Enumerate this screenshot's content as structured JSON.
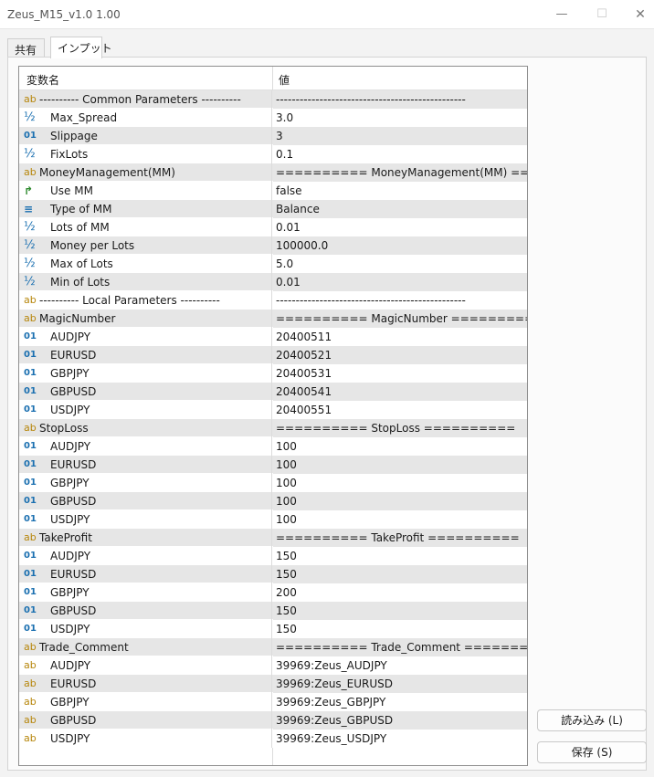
{
  "window": {
    "title": "Zeus_M15_v1.0 1.00",
    "minimize": "—",
    "maximize": "☐",
    "close": "✕"
  },
  "tabs": [
    {
      "label": "共有",
      "active": false
    },
    {
      "label": "インプット",
      "active": true
    }
  ],
  "grid": {
    "col_name": "変数名",
    "col_value": "値",
    "rows": [
      {
        "icon": "ab",
        "icon_name": "string-type-icon",
        "name": "----------    Common Parameters    ----------",
        "value": "------------------------------------------------",
        "top": true
      },
      {
        "icon": "½",
        "icon_name": "double-type-icon",
        "name": "Max_Spread",
        "value": "3.0"
      },
      {
        "icon": "01",
        "icon_name": "integer-type-icon",
        "name": "Slippage",
        "value": "3"
      },
      {
        "icon": "½",
        "icon_name": "double-type-icon",
        "name": "FixLots",
        "value": "0.1"
      },
      {
        "icon": "ab",
        "icon_name": "string-type-icon",
        "name": "MoneyManagement(MM)",
        "value": "  ==========  MoneyManagement(MM) ====...",
        "top": true
      },
      {
        "icon": "↱",
        "icon_name": "bool-type-icon",
        "name": "Use MM",
        "value": "false"
      },
      {
        "icon": "≡",
        "icon_name": "enum-type-icon",
        "name": "Type of MM",
        "value": "Balance"
      },
      {
        "icon": "½",
        "icon_name": "double-type-icon",
        "name": "Lots of MM",
        "value": "0.01"
      },
      {
        "icon": "½",
        "icon_name": "double-type-icon",
        "name": "Money per Lots",
        "value": "100000.0"
      },
      {
        "icon": "½",
        "icon_name": "double-type-icon",
        "name": "Max of Lots",
        "value": "5.0"
      },
      {
        "icon": "½",
        "icon_name": "double-type-icon",
        "name": "Min of Lots",
        "value": "0.01"
      },
      {
        "icon": "ab",
        "icon_name": "string-type-icon",
        "name": "----------    Local Parameters    ----------",
        "value": "------------------------------------------------",
        "top": true
      },
      {
        "icon": "ab",
        "icon_name": "string-type-icon",
        "name": "MagicNumber",
        "value": "  ==========  MagicNumber ==========",
        "top": true
      },
      {
        "icon": "01",
        "icon_name": "integer-type-icon",
        "name": "AUDJPY",
        "value": "20400511"
      },
      {
        "icon": "01",
        "icon_name": "integer-type-icon",
        "name": "EURUSD",
        "value": "20400521"
      },
      {
        "icon": "01",
        "icon_name": "integer-type-icon",
        "name": "GBPJPY",
        "value": "20400531"
      },
      {
        "icon": "01",
        "icon_name": "integer-type-icon",
        "name": "GBPUSD",
        "value": "20400541"
      },
      {
        "icon": "01",
        "icon_name": "integer-type-icon",
        "name": "USDJPY",
        "value": "20400551"
      },
      {
        "icon": "ab",
        "icon_name": "string-type-icon",
        "name": "StopLoss",
        "value": "  ==========  StopLoss ==========",
        "top": true
      },
      {
        "icon": "01",
        "icon_name": "integer-type-icon",
        "name": "AUDJPY",
        "value": "100"
      },
      {
        "icon": "01",
        "icon_name": "integer-type-icon",
        "name": "EURUSD",
        "value": "100"
      },
      {
        "icon": "01",
        "icon_name": "integer-type-icon",
        "name": "GBPJPY",
        "value": "100"
      },
      {
        "icon": "01",
        "icon_name": "integer-type-icon",
        "name": "GBPUSD",
        "value": "100"
      },
      {
        "icon": "01",
        "icon_name": "integer-type-icon",
        "name": "USDJPY",
        "value": "100"
      },
      {
        "icon": "ab",
        "icon_name": "string-type-icon",
        "name": "TakeProfit",
        "value": "  ==========  TakeProfit ==========",
        "top": true
      },
      {
        "icon": "01",
        "icon_name": "integer-type-icon",
        "name": "AUDJPY",
        "value": "150"
      },
      {
        "icon": "01",
        "icon_name": "integer-type-icon",
        "name": "EURUSD",
        "value": "150"
      },
      {
        "icon": "01",
        "icon_name": "integer-type-icon",
        "name": "GBPJPY",
        "value": "200"
      },
      {
        "icon": "01",
        "icon_name": "integer-type-icon",
        "name": "GBPUSD",
        "value": "150"
      },
      {
        "icon": "01",
        "icon_name": "integer-type-icon",
        "name": "USDJPY",
        "value": "150"
      },
      {
        "icon": "ab",
        "icon_name": "string-type-icon",
        "name": "Trade_Comment",
        "value": "  ==========  Trade_Comment ==========",
        "top": true
      },
      {
        "icon": "ab",
        "icon_name": "string-type-icon",
        "name": "AUDJPY",
        "value": "39969:Zeus_AUDJPY"
      },
      {
        "icon": "ab",
        "icon_name": "string-type-icon",
        "name": "EURUSD",
        "value": "39969:Zeus_EURUSD"
      },
      {
        "icon": "ab",
        "icon_name": "string-type-icon",
        "name": "GBPJPY",
        "value": "39969:Zeus_GBPJPY"
      },
      {
        "icon": "ab",
        "icon_name": "string-type-icon",
        "name": "GBPUSD",
        "value": "39969:Zeus_GBPUSD"
      },
      {
        "icon": "ab",
        "icon_name": "string-type-icon",
        "name": "USDJPY",
        "value": "39969:Zeus_USDJPY"
      }
    ]
  },
  "buttons": {
    "load": "読み込み (L)",
    "save": "保存 (S)"
  }
}
